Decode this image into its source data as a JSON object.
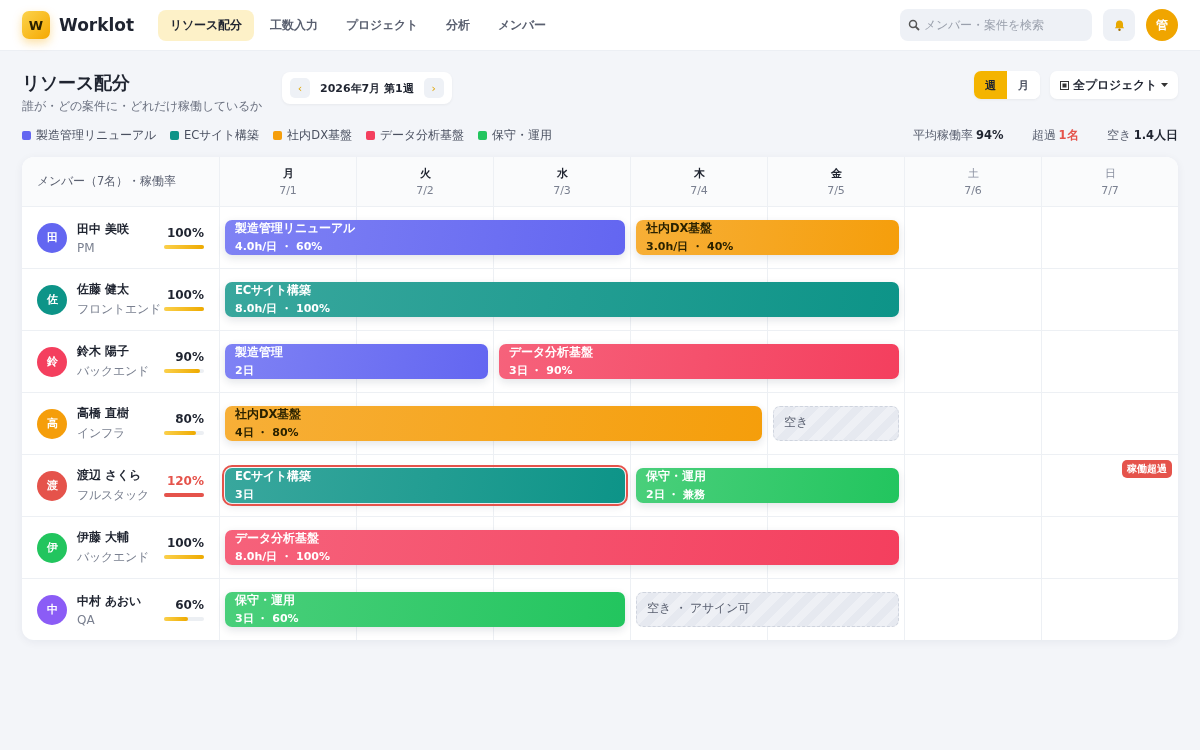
{
  "app": {
    "logo": "W",
    "name": "Worklot"
  },
  "nav": [
    {
      "label": "リソース配分",
      "selected": true
    },
    {
      "label": "工数入力",
      "selected": false
    },
    {
      "label": "プロジェクト",
      "selected": false
    },
    {
      "label": "分析",
      "selected": false
    },
    {
      "label": "メンバー",
      "selected": false
    }
  ],
  "search": {
    "placeholder": "メンバー・案件を検索"
  },
  "user": {
    "avatar": "管"
  },
  "page": {
    "title": "リソース配分",
    "subtitle": "誰が・どの案件に・どれだけ稼働しているか"
  },
  "period": {
    "prev": "‹",
    "label": "2026年7月 第1週",
    "next": "›"
  },
  "view_toggle": [
    {
      "label": "週",
      "selected": true
    },
    {
      "label": "月",
      "selected": false
    }
  ],
  "project_filter": {
    "label": "全プロジェクト"
  },
  "legend": [
    {
      "label": "製造管理リニューアル",
      "color": "#6366f1"
    },
    {
      "label": "ECサイト構築",
      "color": "#0d9488"
    },
    {
      "label": "社内DX基盤",
      "color": "#f59e0b"
    },
    {
      "label": "データ分析基盤",
      "color": "#f43f5e"
    },
    {
      "label": "保守・運用",
      "color": "#22c55e"
    }
  ],
  "stats": [
    {
      "label": "平均稼働率",
      "value": "94%",
      "alert": false
    },
    {
      "label": "超過",
      "value": "1名",
      "alert": true
    },
    {
      "label": "空き",
      "value": "1.4人日",
      "alert": false
    }
  ],
  "table": {
    "member_header": "メンバー（7名）・稼働率",
    "days": [
      {
        "day": "月",
        "date": "7/1",
        "weekend": false
      },
      {
        "day": "火",
        "date": "7/2",
        "weekend": false
      },
      {
        "day": "水",
        "date": "7/3",
        "weekend": false
      },
      {
        "day": "木",
        "date": "7/4",
        "weekend": false
      },
      {
        "day": "金",
        "date": "7/5",
        "weekend": false
      },
      {
        "day": "土",
        "date": "7/6",
        "weekend": true
      },
      {
        "day": "日",
        "date": "7/7",
        "weekend": true
      }
    ],
    "members": [
      {
        "avatar": "田",
        "color": "#6366f1",
        "name": "田中 美咲",
        "role": "PM",
        "rate": "100%",
        "level": 1,
        "over": false,
        "bars": [
          {
            "kind": "assignment",
            "title": "製造管理リニューアル",
            "detail": "4.0h/日 ・ 60%",
            "color": "#6366f1",
            "over": false,
            "days": [
              true,
              true,
              true,
              false,
              false,
              false,
              false
            ]
          },
          {
            "kind": "assignment",
            "title": "社内DX基盤",
            "detail": "3.0h/日 ・ 40%",
            "color": "#f59e0b",
            "over": false,
            "days": [
              false,
              false,
              false,
              true,
              true,
              false,
              false
            ]
          }
        ]
      },
      {
        "avatar": "佐",
        "color": "#0d9488",
        "name": "佐藤 健太",
        "role": "フロントエンド",
        "rate": "100%",
        "level": 1,
        "over": false,
        "bars": [
          {
            "kind": "assignment",
            "title": "ECサイト構築",
            "detail": "8.0h/日 ・ 100%",
            "color": "#0d9488",
            "over": false,
            "days": [
              true,
              true,
              true,
              true,
              true,
              false,
              false
            ]
          }
        ]
      },
      {
        "avatar": "鈴",
        "color": "#f43f5e",
        "name": "鈴木 陽子",
        "role": "バックエンド",
        "rate": "90%",
        "level": 0.9,
        "over": false,
        "bars": [
          {
            "kind": "assignment",
            "title": "製造管理",
            "detail": "2日",
            "color": "#6366f1",
            "over": false,
            "days": [
              true,
              true,
              false,
              false,
              false,
              false,
              false
            ]
          },
          {
            "kind": "assignment",
            "title": "データ分析基盤",
            "detail": "3日 ・ 90%",
            "color": "#f43f5e",
            "over": false,
            "days": [
              false,
              false,
              true,
              true,
              true,
              false,
              false
            ]
          }
        ]
      },
      {
        "avatar": "高",
        "color": "#f59e0b",
        "name": "高橋 直樹",
        "role": "インフラ",
        "rate": "80%",
        "level": 0.8,
        "over": false,
        "bars": [
          {
            "kind": "assignment",
            "title": "社内DX基盤",
            "detail": "4日 ・ 80%",
            "color": "#f59e0b",
            "over": false,
            "days": [
              true,
              true,
              true,
              true,
              false,
              false,
              false
            ]
          },
          {
            "kind": "free",
            "title": "空き",
            "days": [
              false,
              false,
              false,
              false,
              true,
              false,
              false
            ]
          }
        ]
      },
      {
        "avatar": "渡",
        "color": "#e5534b",
        "name": "渡辺 さくら",
        "role": "フルスタック",
        "rate": "120%",
        "level": 1,
        "over": true,
        "badge": "稼働超過",
        "bars": [
          {
            "kind": "assignment",
            "title": "ECサイト構築",
            "detail": "3日",
            "color": "#0d9488",
            "over": true,
            "days": [
              true,
              true,
              true,
              false,
              false,
              false,
              false
            ]
          },
          {
            "kind": "assignment",
            "title": "保守・運用",
            "detail": "2日 ・ 兼務",
            "color": "#22c55e",
            "over": false,
            "days": [
              false,
              false,
              false,
              true,
              true,
              false,
              false
            ]
          }
        ]
      },
      {
        "avatar": "伊",
        "color": "#22c55e",
        "name": "伊藤 大輔",
        "role": "バックエンド",
        "rate": "100%",
        "level": 1,
        "over": false,
        "bars": [
          {
            "kind": "assignment",
            "title": "データ分析基盤",
            "detail": "8.0h/日 ・ 100%",
            "color": "#f43f5e",
            "over": false,
            "days": [
              true,
              true,
              true,
              true,
              true,
              false,
              false
            ]
          }
        ]
      },
      {
        "avatar": "中",
        "color": "#8b5cf6",
        "name": "中村 あおい",
        "role": "QA",
        "rate": "60%",
        "level": 0.6,
        "over": false,
        "bars": [
          {
            "kind": "assignment",
            "title": "保守・運用",
            "detail": "3日 ・ 60%",
            "color": "#22c55e",
            "over": false,
            "days": [
              true,
              true,
              true,
              false,
              false,
              false,
              false
            ]
          },
          {
            "kind": "free",
            "title": "空き ・ アサイン可",
            "days": [
              false,
              false,
              false,
              true,
              true,
              false,
              false
            ]
          }
        ]
      }
    ]
  }
}
